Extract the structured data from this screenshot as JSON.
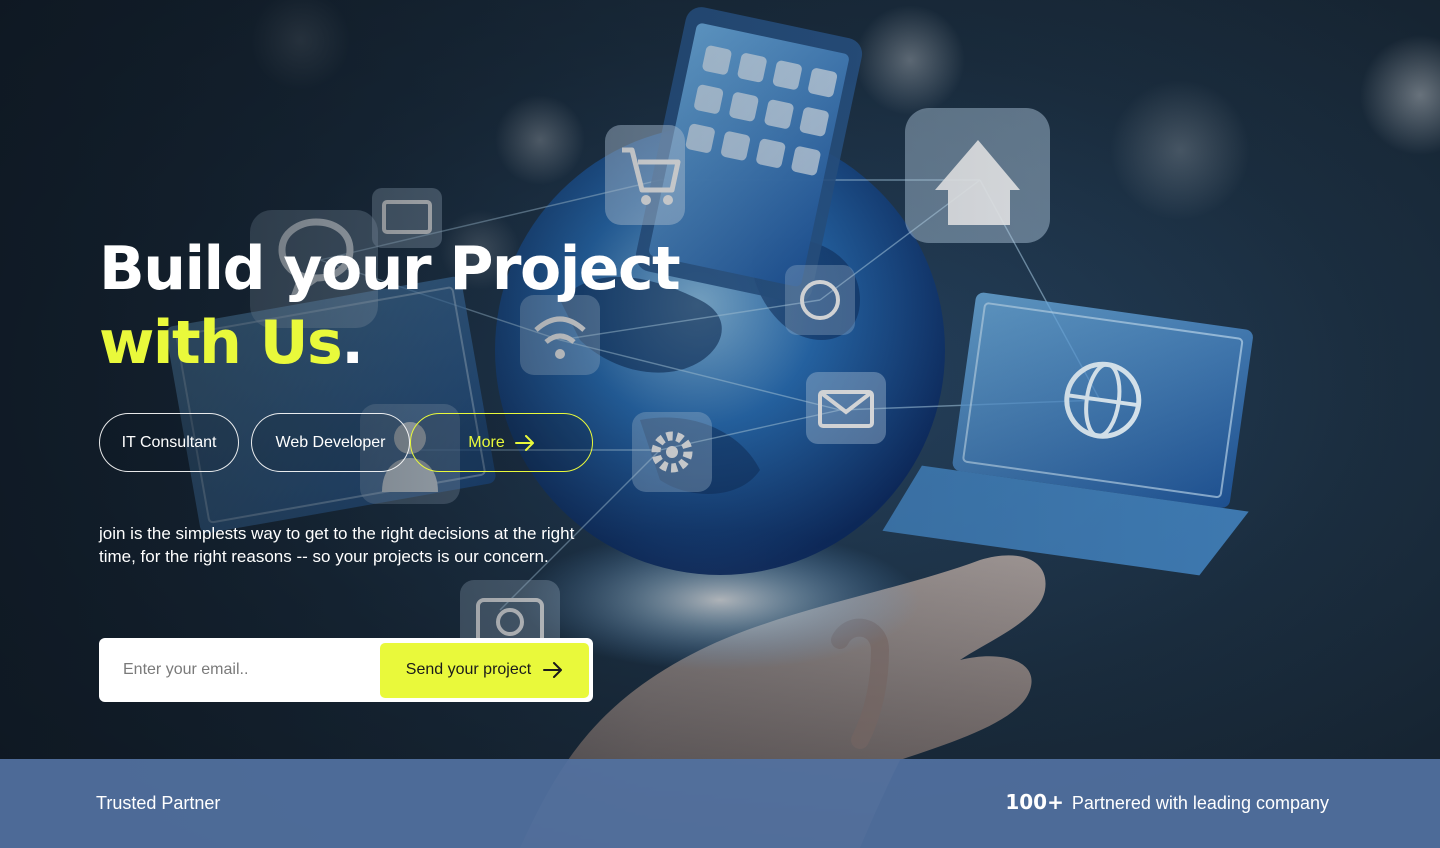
{
  "hero": {
    "title_line1": "Build your Project",
    "title_line2": "with Us",
    "title_period": ".",
    "description": "join is the simplests way to get to the right decisions at the right time,  for the right reasons -- so your projects is our concern."
  },
  "tags": {
    "it_consultant": "IT Consultant",
    "web_developer": "Web Developer",
    "more": "More"
  },
  "signup": {
    "email_placeholder": "Enter your email..",
    "send_label": "Send your project"
  },
  "trust_bar": {
    "label": "Trusted Partner",
    "count": "100+",
    "count_text": "Partnered with leading company"
  },
  "icons": {
    "more_arrow": "arrow-right-icon",
    "send_arrow": "arrow-right-icon",
    "background_app_icons": [
      "chat-icon",
      "cart-icon",
      "home-icon",
      "wifi-icon",
      "mail-icon",
      "gear-icon",
      "globe-icon",
      "camera-icon",
      "user-icon",
      "phone-icon",
      "laptop-icon",
      "monitor-icon"
    ]
  },
  "colors": {
    "accent": "#e9f93b",
    "text": "#ffffff",
    "trust_bar": "#5271a0",
    "background_dark": "#1a2a38"
  }
}
